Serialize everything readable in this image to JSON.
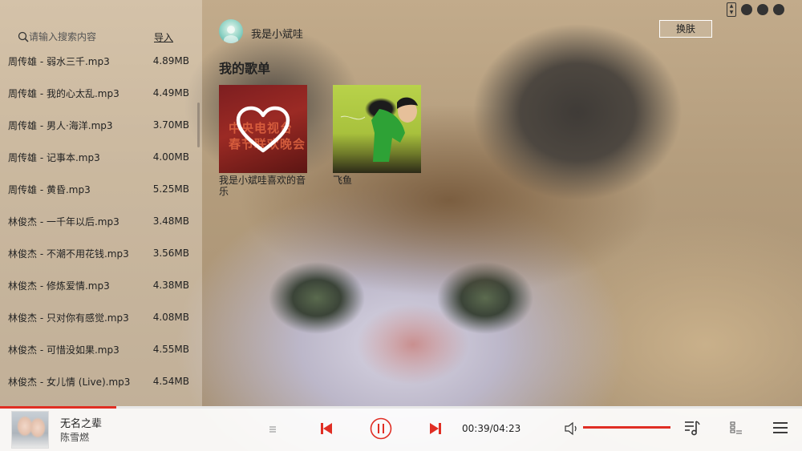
{
  "search": {
    "placeholder": "请输入搜索内容"
  },
  "import_label": "导入",
  "songs": [
    {
      "name": "周传雄 - 弱水三千.mp3",
      "size": "4.89MB"
    },
    {
      "name": "周传雄 - 我的心太乱.mp3",
      "size": "4.49MB"
    },
    {
      "name": "周传雄 - 男人·海洋.mp3",
      "size": "3.70MB"
    },
    {
      "name": "周传雄 - 记事本.mp3",
      "size": "4.00MB"
    },
    {
      "name": "周传雄 - 黄昏.mp3",
      "size": "5.25MB"
    },
    {
      "name": "林俊杰 - 一千年以后.mp3",
      "size": "3.48MB"
    },
    {
      "name": "林俊杰 - 不潮不用花钱.mp3",
      "size": "3.56MB"
    },
    {
      "name": "林俊杰 - 修炼爱情.mp3",
      "size": "4.38MB"
    },
    {
      "name": "林俊杰 - 只对你有感觉.mp3",
      "size": "4.08MB"
    },
    {
      "name": "林俊杰 - 可惜没如果.mp3",
      "size": "4.55MB"
    },
    {
      "name": "林俊杰 - 女儿情 (Live).mp3",
      "size": "4.54MB"
    }
  ],
  "header": {
    "user_name": "我是小斌哇",
    "skin_button": "换肤"
  },
  "playlists": {
    "title": "我的歌单",
    "items": [
      {
        "name": "我是小斌哇喜欢的音乐"
      },
      {
        "name": "飞鱼"
      }
    ]
  },
  "player": {
    "title": "无名之辈",
    "artist": "陈雪燃",
    "time": "00:39/04:23",
    "progress": 0.145,
    "volume": 1.0
  },
  "colors": {
    "accent": "#e02e24",
    "sidebar_bg": "rgba(255,250,240,0.30)"
  },
  "icons": {
    "search": "search-icon",
    "heart": "heart-icon",
    "prev": "previous-icon",
    "pause": "pause-icon",
    "next": "next-icon",
    "volume": "volume-icon",
    "lyrics": "lyrics-icon",
    "playlist_queue": "queue-icon",
    "menu": "menu-icon"
  }
}
